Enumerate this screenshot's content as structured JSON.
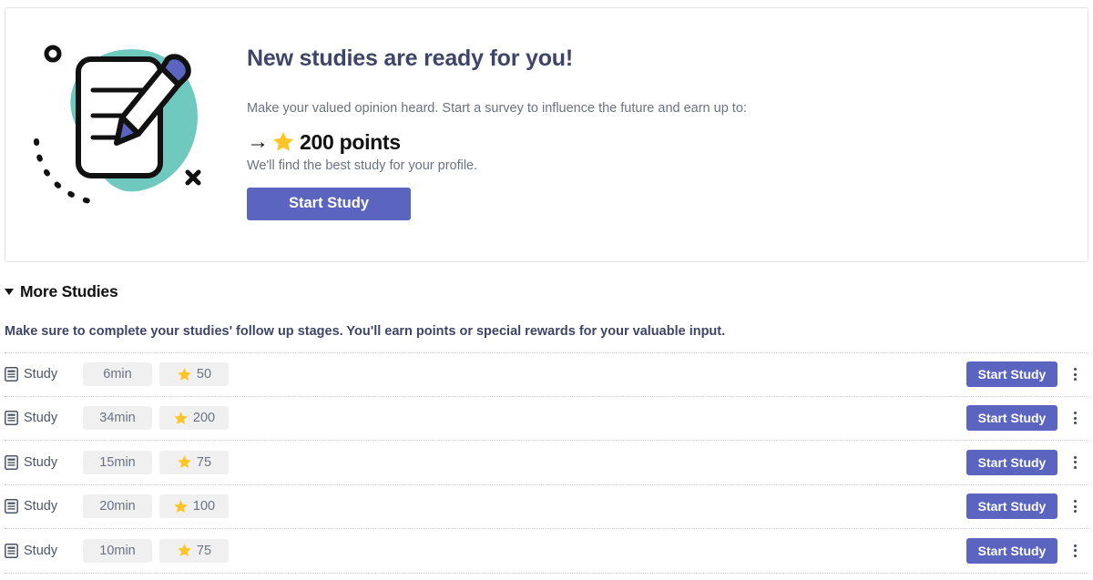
{
  "hero": {
    "title": "New studies are ready for you!",
    "subtitle": "Make your valued opinion heard. Start a survey to influence the future and earn up to:",
    "arrow": "→",
    "points_text": "200 points",
    "note": "We'll find the best study for your profile.",
    "cta_label": "Start Study",
    "illustration_name": "survey-document-pencil-illustration"
  },
  "more_studies": {
    "caret": "▼",
    "title": "More Studies",
    "description": "Make sure to complete your studies' follow up stages. You'll earn points or special rewards for your valuable input.",
    "rows": [
      {
        "label": "Study",
        "duration": "6min",
        "points": "50",
        "cta_label": "Start Study"
      },
      {
        "label": "Study",
        "duration": "34min",
        "points": "200",
        "cta_label": "Start Study"
      },
      {
        "label": "Study",
        "duration": "15min",
        "points": "75",
        "cta_label": "Start Study"
      },
      {
        "label": "Study",
        "duration": "20min",
        "points": "100",
        "cta_label": "Start Study"
      },
      {
        "label": "Study",
        "duration": "10min",
        "points": "75",
        "cta_label": "Start Study"
      }
    ]
  },
  "colors": {
    "accent_purple": "#5b65c0",
    "teal_blob": "#6fc9bf",
    "star_gold": "#ffc528",
    "heading_navy": "#3f4566",
    "badge_bg": "#f0f0f0",
    "muted_text": "#6b7280"
  }
}
